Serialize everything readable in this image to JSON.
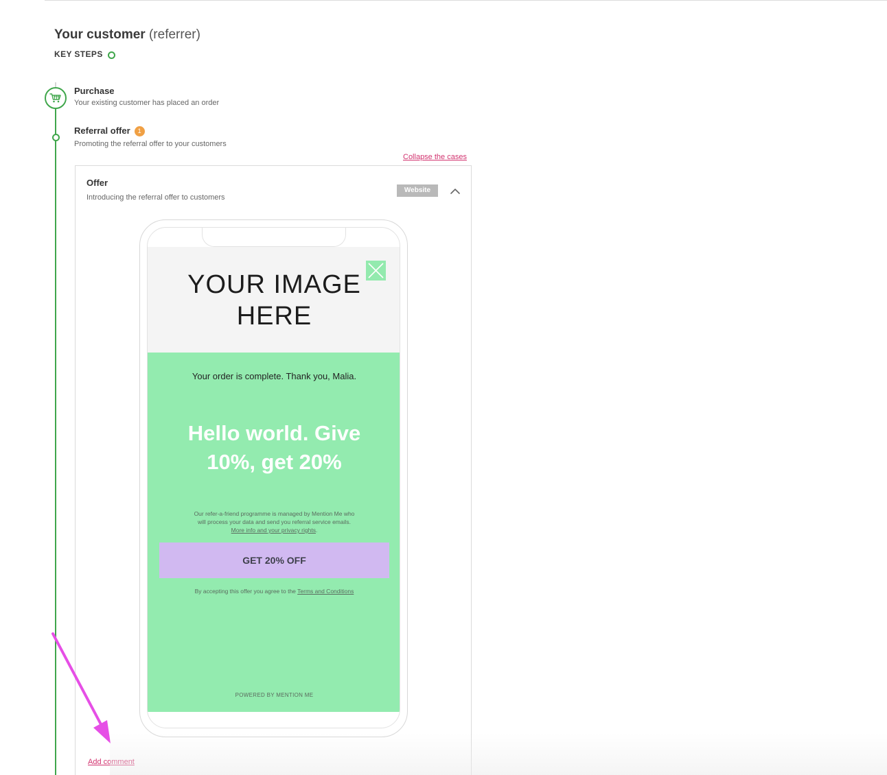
{
  "section": {
    "title_strong": "Your customer",
    "title_light": "(referrer)",
    "key_steps_label": "KEY STEPS"
  },
  "steps": [
    {
      "title": "Purchase",
      "description": "Your existing customer has placed an order",
      "icon": "shopping-cart-icon"
    },
    {
      "title": "Referral offer",
      "badge": "1",
      "description": "Promoting the referral offer to your customers"
    }
  ],
  "collapse_link": "Collapse the cases",
  "offer_card": {
    "title": "Offer",
    "description": "Introducing the referral offer to customers",
    "channel_tag": "Website",
    "toggle_icon": "chevron-up-icon"
  },
  "preview": {
    "image_placeholder_line1": "YOUR IMAGE",
    "image_placeholder_line2": "HERE",
    "close_icon": "close-icon",
    "order_message": "Your order is complete. Thank you, Malia.",
    "headline_line1": "Hello world. Give",
    "headline_line2": "10%, get 20%",
    "privacy_text_line1": "Our refer-a-friend programme is managed by Mention Me who",
    "privacy_text_line2": "will process your data and send you referral service emails.",
    "privacy_link": "More info and your privacy rights",
    "privacy_link_suffix": ".",
    "cta_label": "GET 20% OFF",
    "terms_prefix": "By accepting this offer you agree to the",
    "terms_link": "Terms and Conditions",
    "powered_by": "POWERED BY MENTION ME",
    "colors": {
      "background": "#93ebaf",
      "cta": "#d1b9f1",
      "headline": "#ffffff"
    }
  },
  "add_comment": "Add comment",
  "colors": {
    "accent_green": "#3fa64b",
    "link_pink": "#d2336f",
    "badge_orange": "#f0a044",
    "annotation_arrow": "#e64fe6"
  }
}
